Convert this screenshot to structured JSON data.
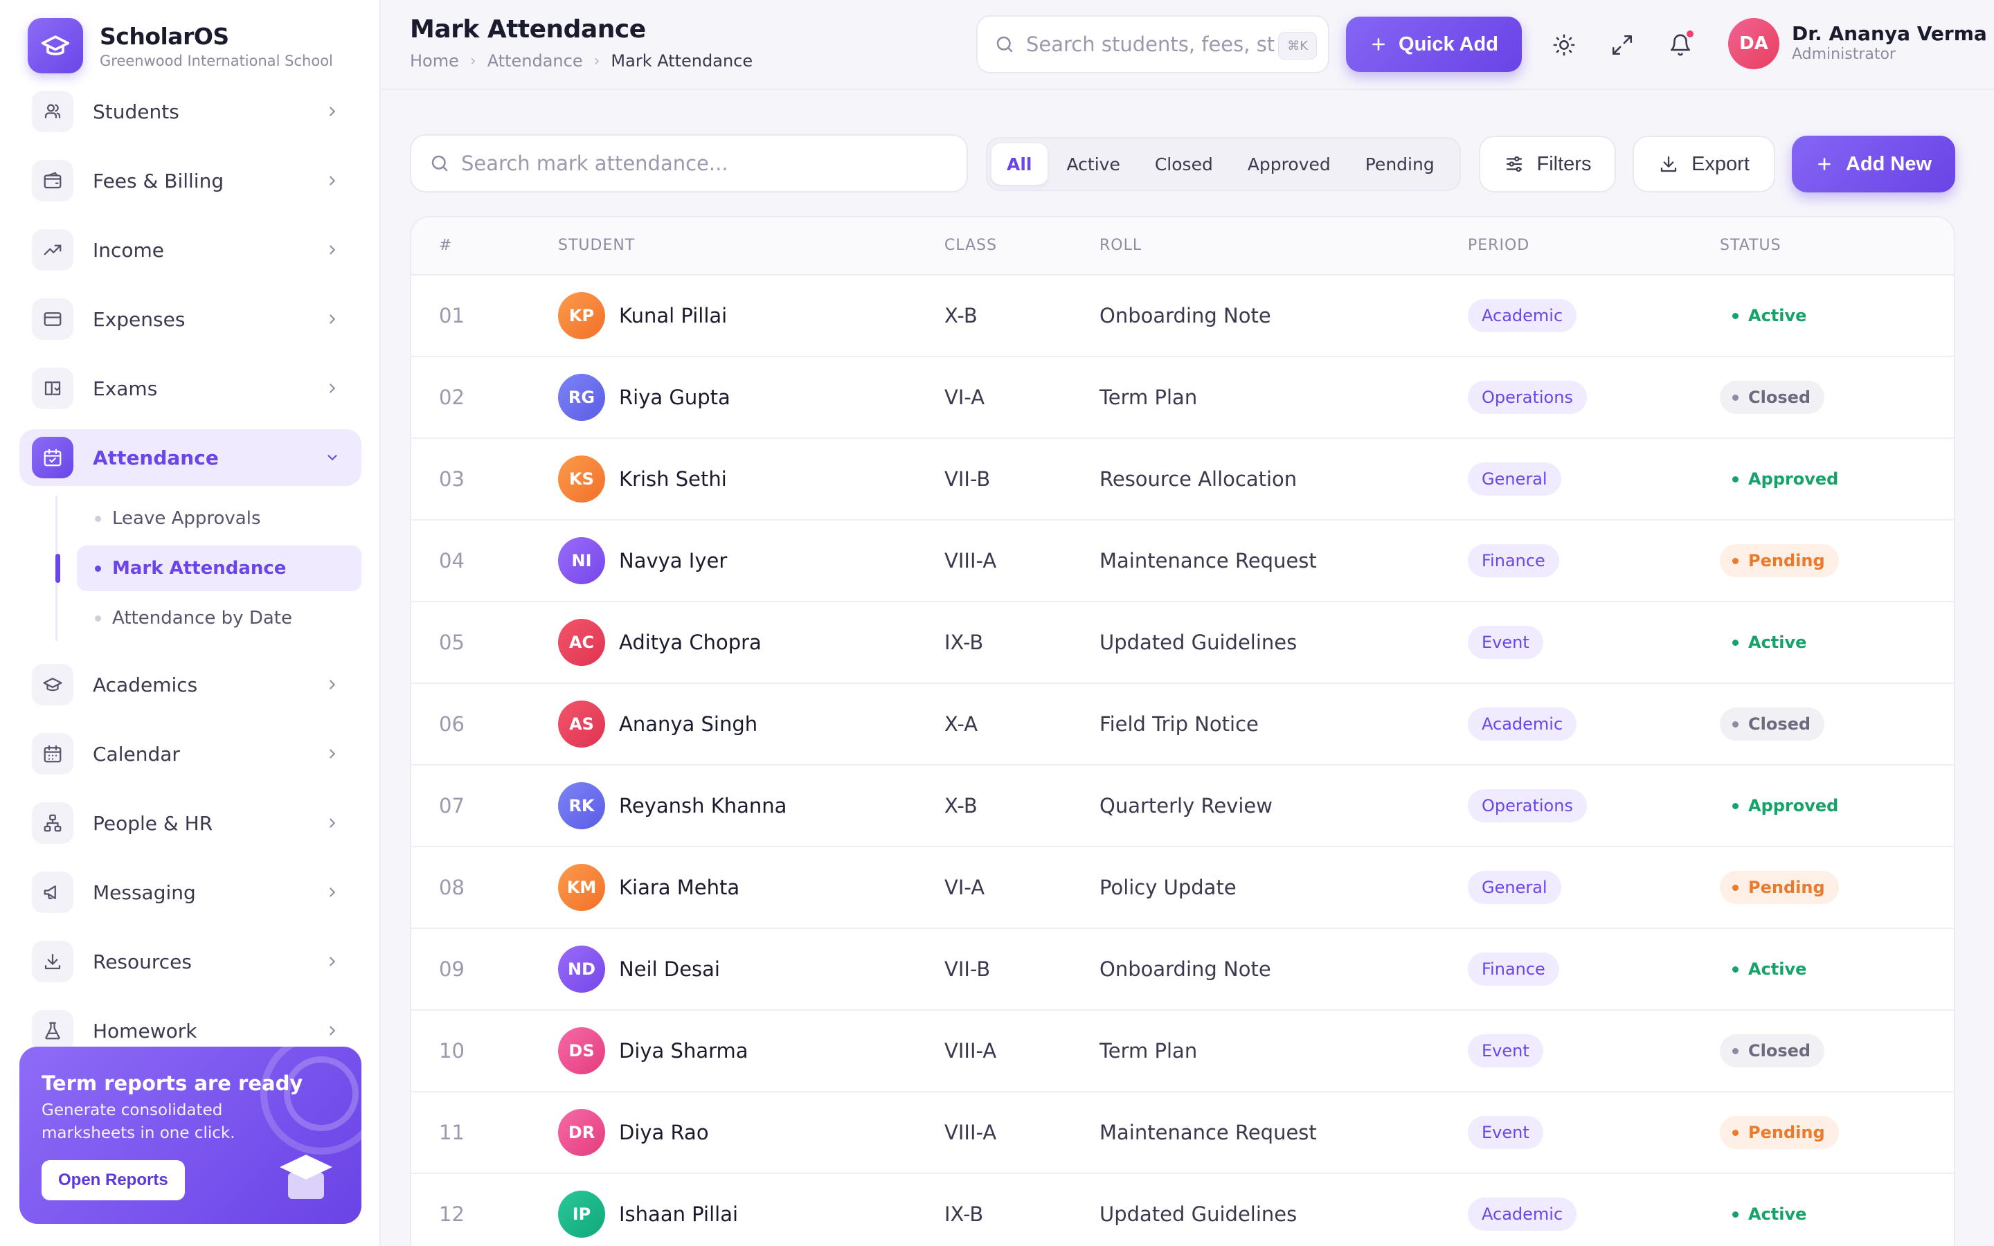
{
  "brand": {
    "name": "ScholarOS",
    "subtitle": "Greenwood International School"
  },
  "sidebar": {
    "items": [
      {
        "label": "Students",
        "icon": "users-icon"
      },
      {
        "label": "Fees & Billing",
        "icon": "wallet-icon"
      },
      {
        "label": "Income",
        "icon": "trending-up-icon"
      },
      {
        "label": "Expenses",
        "icon": "card-icon"
      },
      {
        "label": "Exams",
        "icon": "book-check-icon"
      },
      {
        "label": "Attendance",
        "icon": "calendar-check-icon",
        "active": true
      },
      {
        "label": "Academics",
        "icon": "graduation-cap-icon"
      },
      {
        "label": "Calendar",
        "icon": "calendar-icon"
      },
      {
        "label": "People & HR",
        "icon": "org-chart-icon"
      },
      {
        "label": "Messaging",
        "icon": "megaphone-icon"
      },
      {
        "label": "Resources",
        "icon": "download-icon"
      },
      {
        "label": "Homework",
        "icon": "flask-icon"
      }
    ],
    "subitems": [
      {
        "label": "Leave Approvals"
      },
      {
        "label": "Mark Attendance",
        "active": true
      },
      {
        "label": "Attendance by Date"
      }
    ],
    "promo": {
      "title": "Term reports are ready",
      "text": "Generate consolidated marksheets in one click.",
      "button": "Open Reports"
    }
  },
  "header": {
    "title": "Mark Attendance",
    "breadcrumbs": [
      "Home",
      "Attendance",
      "Mark Attendance"
    ],
    "search_placeholder": "Search students, fees, staff...",
    "shortcut": "⌘K",
    "quick_add": "Quick Add",
    "user": {
      "initials": "DA",
      "name": "Dr. Ananya Verma",
      "role": "Administrator"
    }
  },
  "toolbar": {
    "search_placeholder": "Search mark attendance...",
    "filters": [
      "All",
      "Active",
      "Closed",
      "Approved",
      "Pending"
    ],
    "selected_filter": "All",
    "filters_label": "Filters",
    "export_label": "Export",
    "add_new_label": "Add New"
  },
  "table": {
    "columns": [
      "#",
      "STUDENT",
      "CLASS",
      "ROLL",
      "PERIOD",
      "STATUS"
    ],
    "rows": [
      {
        "idx": "01",
        "initials": "KP",
        "name": "Kunal Pillai",
        "cls": "X-B",
        "roll": "Onboarding Note",
        "period": "Academic",
        "status": "Active",
        "avatar_color": "orange"
      },
      {
        "idx": "02",
        "initials": "RG",
        "name": "Riya Gupta",
        "cls": "VI-A",
        "roll": "Term Plan",
        "period": "Operations",
        "status": "Closed",
        "avatar_color": "indigo"
      },
      {
        "idx": "03",
        "initials": "KS",
        "name": "Krish Sethi",
        "cls": "VII-B",
        "roll": "Resource Allocation",
        "period": "General",
        "status": "Approved",
        "avatar_color": "orange"
      },
      {
        "idx": "04",
        "initials": "NI",
        "name": "Navya Iyer",
        "cls": "VIII-A",
        "roll": "Maintenance Request",
        "period": "Finance",
        "status": "Pending",
        "avatar_color": "purple"
      },
      {
        "idx": "05",
        "initials": "AC",
        "name": "Aditya Chopra",
        "cls": "IX-B",
        "roll": "Updated Guidelines",
        "period": "Event",
        "status": "Active",
        "avatar_color": "red"
      },
      {
        "idx": "06",
        "initials": "AS",
        "name": "Ananya Singh",
        "cls": "X-A",
        "roll": "Field Trip Notice",
        "period": "Academic",
        "status": "Closed",
        "avatar_color": "red"
      },
      {
        "idx": "07",
        "initials": "RK",
        "name": "Reyansh Khanna",
        "cls": "X-B",
        "roll": "Quarterly Review",
        "period": "Operations",
        "status": "Approved",
        "avatar_color": "indigo"
      },
      {
        "idx": "08",
        "initials": "KM",
        "name": "Kiara Mehta",
        "cls": "VI-A",
        "roll": "Policy Update",
        "period": "General",
        "status": "Pending",
        "avatar_color": "orange"
      },
      {
        "idx": "09",
        "initials": "ND",
        "name": "Neil Desai",
        "cls": "VII-B",
        "roll": "Onboarding Note",
        "period": "Finance",
        "status": "Active",
        "avatar_color": "purple"
      },
      {
        "idx": "10",
        "initials": "DS",
        "name": "Diya Sharma",
        "cls": "VIII-A",
        "roll": "Term Plan",
        "period": "Event",
        "status": "Closed",
        "avatar_color": "pink"
      },
      {
        "idx": "11",
        "initials": "DR",
        "name": "Diya Rao",
        "cls": "VIII-A",
        "roll": "Maintenance Request",
        "period": "Event",
        "status": "Pending",
        "avatar_color": "pink"
      },
      {
        "idx": "12",
        "initials": "IP",
        "name": "Ishaan Pillai",
        "cls": "IX-B",
        "roll": "Updated Guidelines",
        "period": "Academic",
        "status": "Active",
        "avatar_color": "green"
      }
    ]
  },
  "colors": {
    "accent": "#6A46E8",
    "status": {
      "Active": {
        "fg": "#16A36A",
        "bg": "transparent",
        "dot": "#16A36A"
      },
      "Approved": {
        "fg": "#16A36A",
        "bg": "transparent",
        "dot": "#16A36A"
      },
      "Closed": {
        "fg": "#6B6A7E",
        "bg": "#F1F0F4",
        "dot": "#8C8BA0"
      },
      "Pending": {
        "fg": "#EA7A2C",
        "bg": "#FEF0E6",
        "dot": "#EA7A2C"
      }
    },
    "avatars": {
      "orange": "linear-gradient(135deg,#FB9A4B,#F2712A)",
      "indigo": "linear-gradient(135deg,#7C84F5,#5B5CE6)",
      "purple": "linear-gradient(135deg,#9A6CF8,#7546EA)",
      "red": "linear-gradient(135deg,#F2556A,#DF3452)",
      "pink": "linear-gradient(135deg,#F56AA6,#E53C7E)",
      "green": "linear-gradient(135deg,#2BC79A,#0FA87A)"
    }
  }
}
